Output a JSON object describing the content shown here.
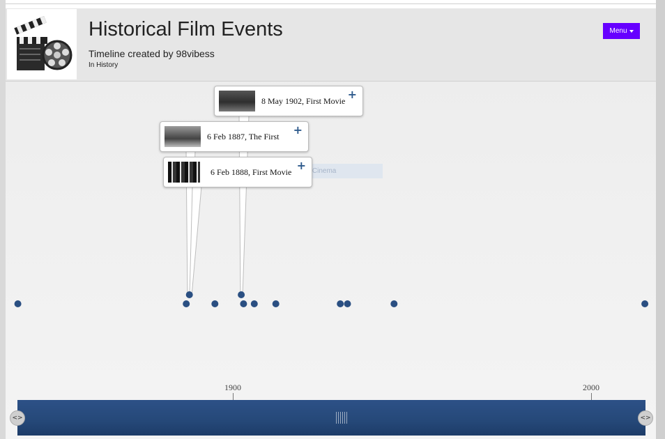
{
  "header": {
    "title": "Historical Film Events",
    "subtitle": "Timeline created by 98vibess",
    "category": "In History",
    "menu_label": "Menu",
    "logo_icon": "film-clapperboard-reel-icon"
  },
  "colors": {
    "menu": "#6600ff",
    "marker": "#2a4f82",
    "nav_bar": "#254878",
    "header_bg": "#e6e6e6"
  },
  "events": [
    {
      "label": "8 May 1902, First Movie",
      "year": 1902.35
    },
    {
      "label": "6 Feb 1887, The First",
      "year": 1887.1
    },
    {
      "label": "6 Feb 1888, First Movie",
      "year": 1888.1
    }
  ],
  "ghost_text": "Lumiere Cinema",
  "marker_years": [
    1840,
    1887,
    1895,
    1903,
    1906,
    1912,
    1930,
    1932,
    1945,
    2015
  ],
  "axis": {
    "ticks": [
      "1900",
      "2000"
    ],
    "range": [
      1840,
      2015
    ]
  },
  "controls": {
    "left_handle": "<>",
    "right_handle": "<>"
  }
}
